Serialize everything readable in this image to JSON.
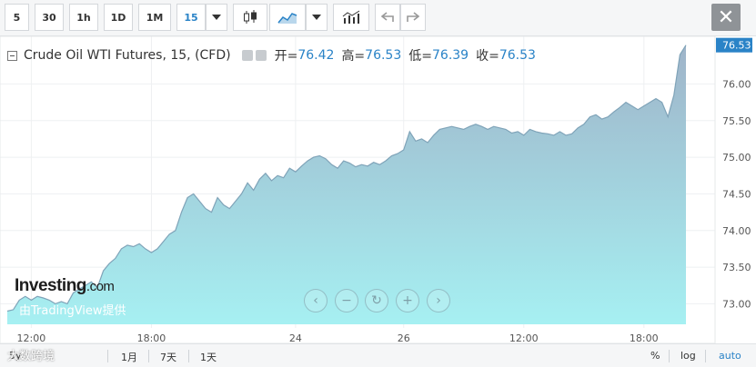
{
  "toolbar": {
    "intervals": [
      "5",
      "30",
      "1h",
      "1D",
      "1M",
      "15"
    ],
    "active_interval": "15",
    "close_label": "✕"
  },
  "legend": {
    "title": "Crude Oil WTI Futures, 15, (CFD)",
    "open_label": "开=",
    "open_value": "76.42",
    "high_label": "高=",
    "high_value": "76.53",
    "low_label": "低=",
    "low_value": "76.39",
    "close_label": "收=",
    "close_value": "76.53"
  },
  "branding": {
    "logo_main": "Investing",
    "logo_suffix": ".com",
    "provider_note": "由TradingView提供"
  },
  "bottom_bar": {
    "ranges": [
      "5y",
      "1月",
      "7天",
      "1天"
    ],
    "percent": "%",
    "log": "log",
    "auto": "auto"
  },
  "watermark": "大数跨境",
  "colors": {
    "accent": "#2a83c7",
    "line": "#7fa3b8",
    "last_price_bg": "#2a83c7"
  },
  "chart_data": {
    "type": "area",
    "title": "Crude Oil WTI Futures, 15, (CFD)",
    "xlabel": "",
    "ylabel": "",
    "ylim": [
      72.72,
      76.65
    ],
    "y_ticks": [
      73.0,
      73.5,
      74.0,
      74.5,
      75.0,
      75.5,
      76.0,
      76.53
    ],
    "x_tick_labels": [
      {
        "label": "12:00",
        "index": 4
      },
      {
        "label": "18:00",
        "index": 24
      },
      {
        "label": "24",
        "index": 48
      },
      {
        "label": "26",
        "index": 66
      },
      {
        "label": "12:00",
        "index": 86
      },
      {
        "label": "18:00",
        "index": 106
      }
    ],
    "last_price": "76.53",
    "grid": true,
    "values": [
      72.9,
      72.92,
      73.05,
      73.1,
      73.05,
      73.1,
      73.08,
      73.05,
      73.0,
      73.03,
      73.0,
      73.15,
      73.2,
      73.25,
      73.3,
      73.22,
      73.45,
      73.55,
      73.62,
      73.75,
      73.8,
      73.78,
      73.82,
      73.75,
      73.7,
      73.75,
      73.85,
      73.95,
      74.0,
      74.25,
      74.45,
      74.5,
      74.4,
      74.3,
      74.25,
      74.45,
      74.35,
      74.3,
      74.4,
      74.5,
      74.65,
      74.55,
      74.7,
      74.78,
      74.68,
      74.75,
      74.72,
      74.85,
      74.8,
      74.88,
      74.95,
      75.0,
      75.02,
      74.98,
      74.9,
      74.85,
      74.95,
      74.92,
      74.87,
      74.9,
      74.88,
      74.93,
      74.9,
      74.95,
      75.02,
      75.05,
      75.1,
      75.35,
      75.22,
      75.25,
      75.2,
      75.3,
      75.38,
      75.4,
      75.42,
      75.4,
      75.38,
      75.42,
      75.45,
      75.42,
      75.38,
      75.42,
      75.4,
      75.38,
      75.33,
      75.35,
      75.3,
      75.38,
      75.35,
      75.33,
      75.32,
      75.3,
      75.35,
      75.3,
      75.32,
      75.4,
      75.45,
      75.55,
      75.58,
      75.52,
      75.55,
      75.62,
      75.68,
      75.75,
      75.7,
      75.65,
      75.7,
      75.75,
      75.8,
      75.75,
      75.55,
      75.85,
      76.4,
      76.53
    ]
  }
}
